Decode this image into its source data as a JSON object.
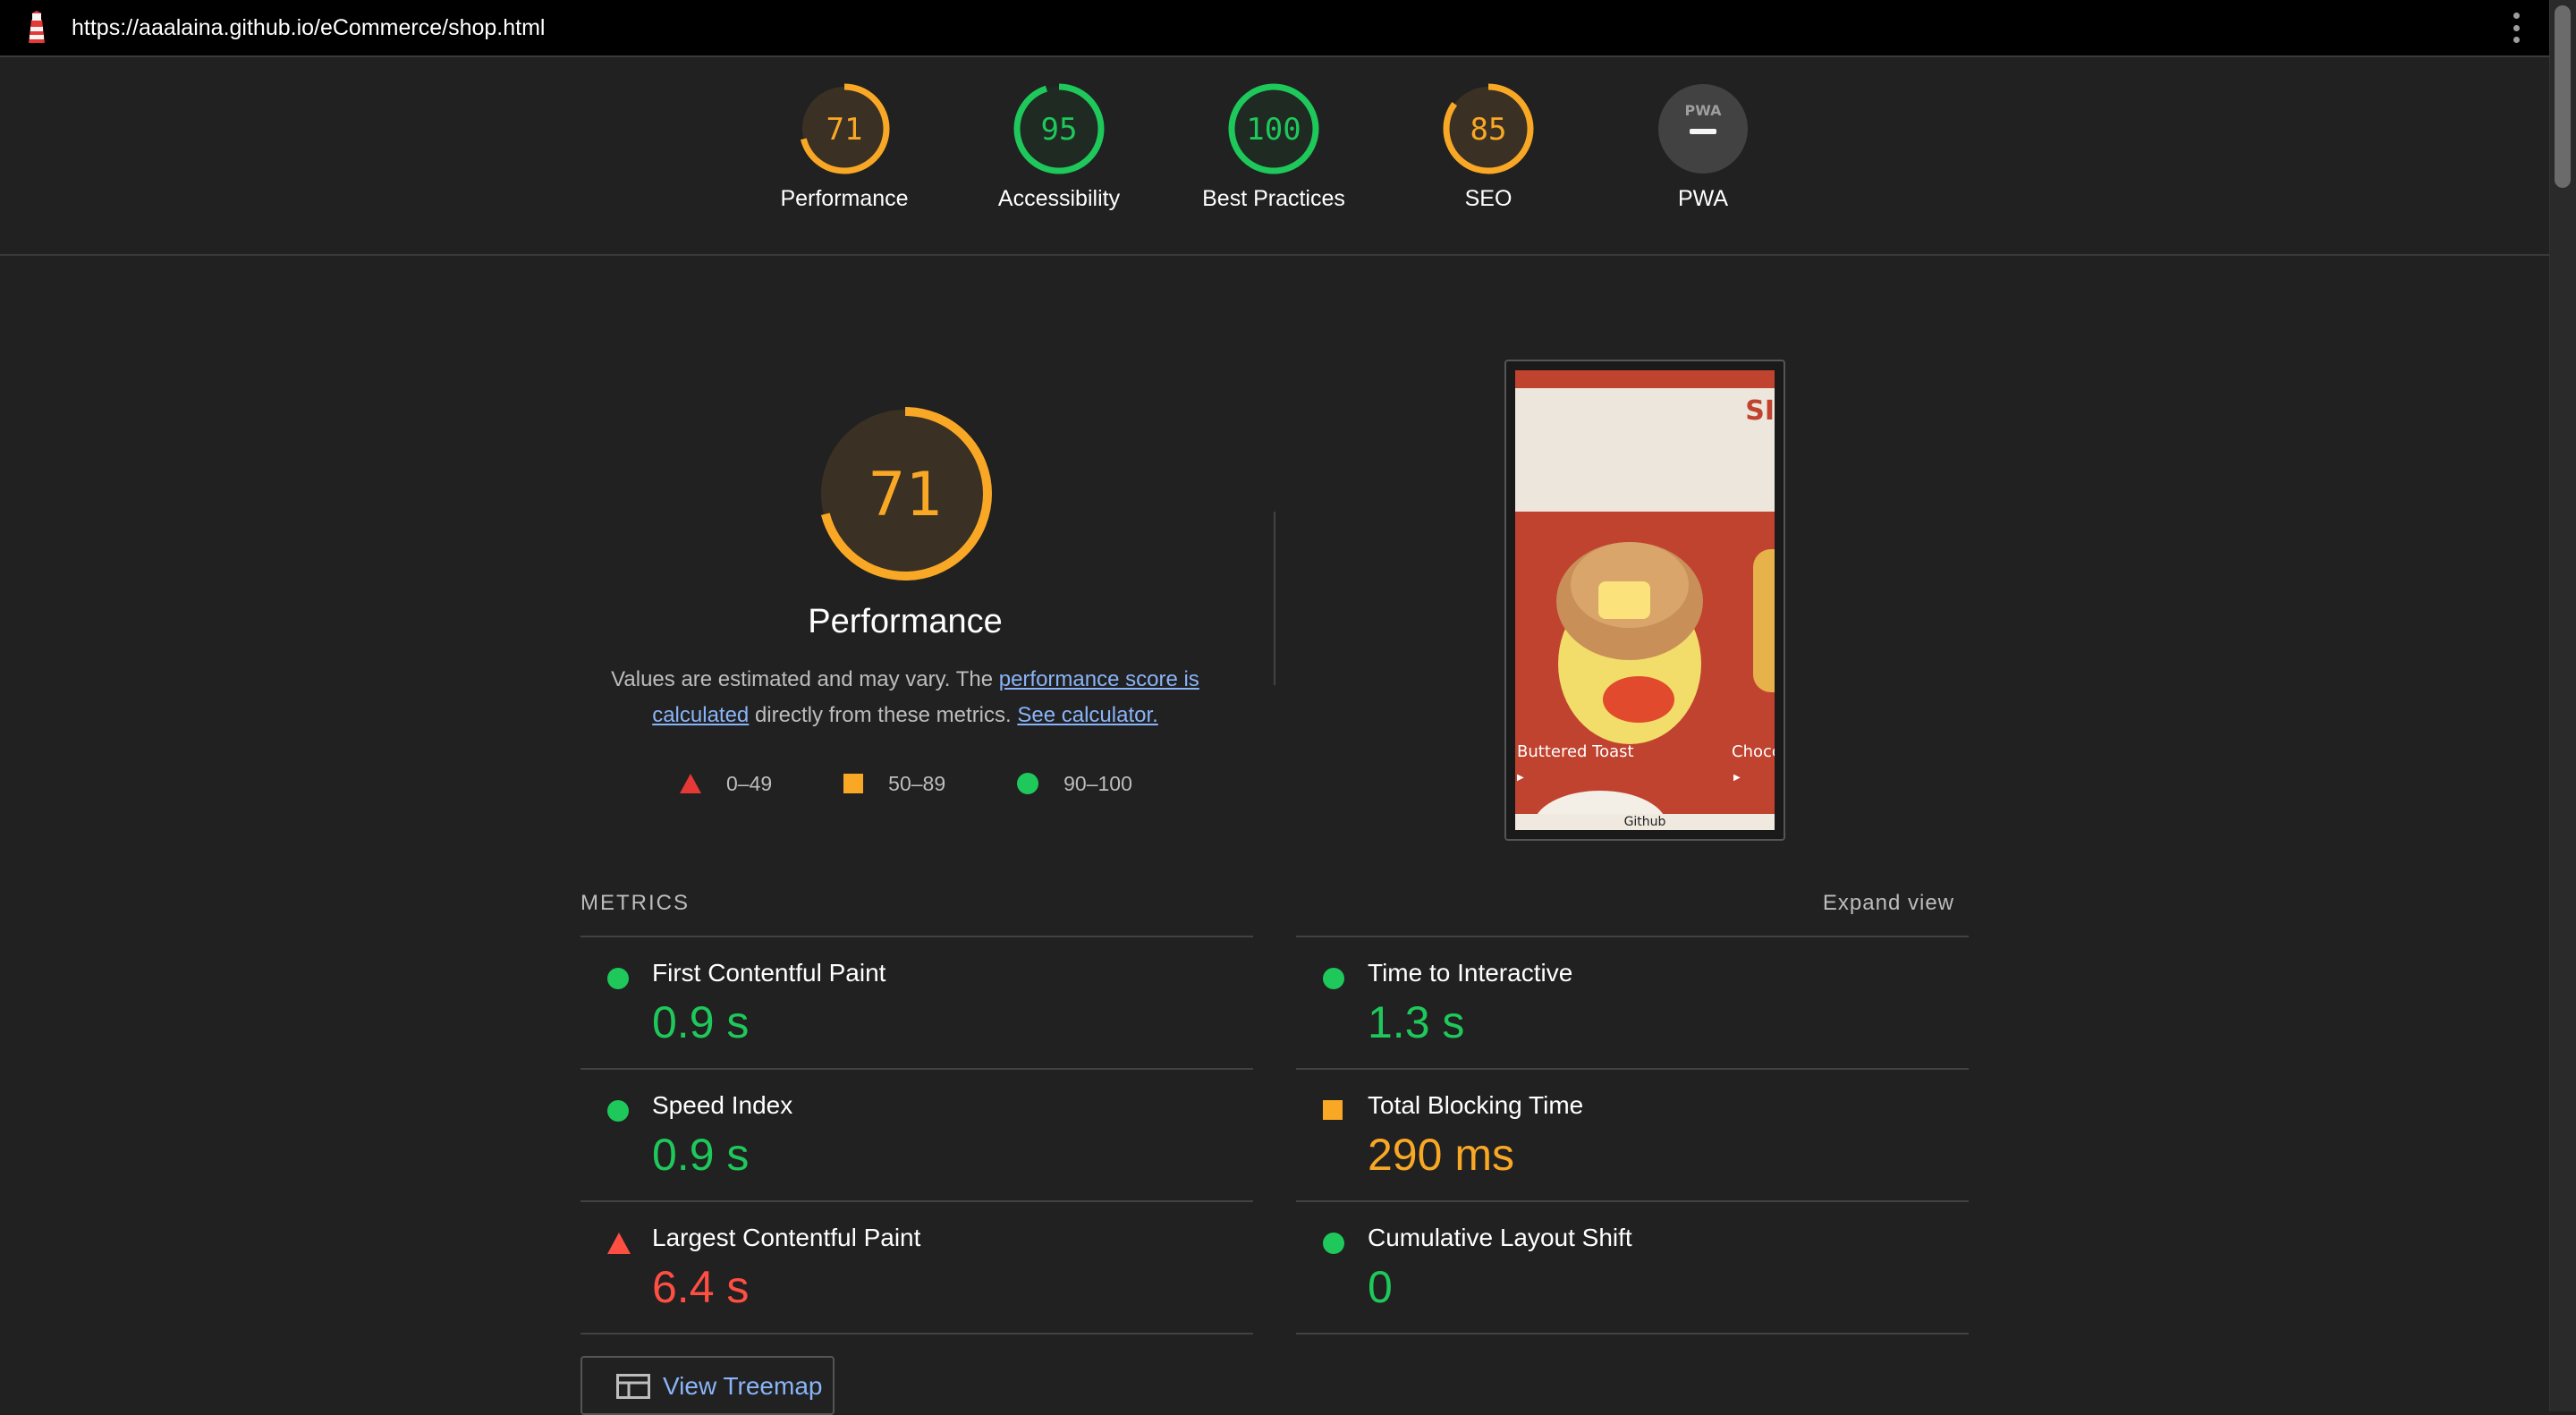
{
  "toolbar": {
    "url": "https://aaalaina.github.io/eCommerce/shop.html"
  },
  "categories": [
    {
      "label": "Performance",
      "score": "71",
      "value": 71,
      "color": "#f9a825"
    },
    {
      "label": "Accessibility",
      "score": "95",
      "value": 95,
      "color": "#1ec85a"
    },
    {
      "label": "Best Practices",
      "score": "100",
      "value": 100,
      "color": "#1ec85a"
    },
    {
      "label": "SEO",
      "score": "85",
      "value": 85,
      "color": "#f9a825"
    },
    {
      "label": "PWA",
      "badge": "PWA",
      "color": "#9e9e9e"
    }
  ],
  "main": {
    "score": "71",
    "score_value": 71,
    "title": "Performance",
    "desc_prefix": "Values are estimated and may vary. The ",
    "desc_link1": "performance score is calculated",
    "desc_middle": " directly from these metrics. ",
    "desc_link2": "See calculator.",
    "legend": [
      "0–49",
      "50–89",
      "90–100"
    ]
  },
  "screenshot": {
    "brand": "SI",
    "product1": "Buttered Toast",
    "product2": "Choco",
    "footer": "Github"
  },
  "metrics": {
    "title": "METRICS",
    "expand": "Expand view",
    "left": [
      {
        "name": "First Contentful Paint",
        "value": "0.9 s",
        "rating": "green"
      },
      {
        "name": "Speed Index",
        "value": "0.9 s",
        "rating": "green"
      },
      {
        "name": "Largest Contentful Paint",
        "value": "6.4 s",
        "rating": "red"
      }
    ],
    "right": [
      {
        "name": "Time to Interactive",
        "value": "1.3 s",
        "rating": "green"
      },
      {
        "name": "Total Blocking Time",
        "value": "290 ms",
        "rating": "orange"
      },
      {
        "name": "Cumulative Layout Shift",
        "value": "0",
        "rating": "green"
      }
    ]
  },
  "treemap": {
    "label": "View Treemap"
  },
  "colors": {
    "pass": "#1ec85a",
    "average": "#f9a825",
    "fail": "#ff4e42",
    "link": "#8ab4f8"
  }
}
